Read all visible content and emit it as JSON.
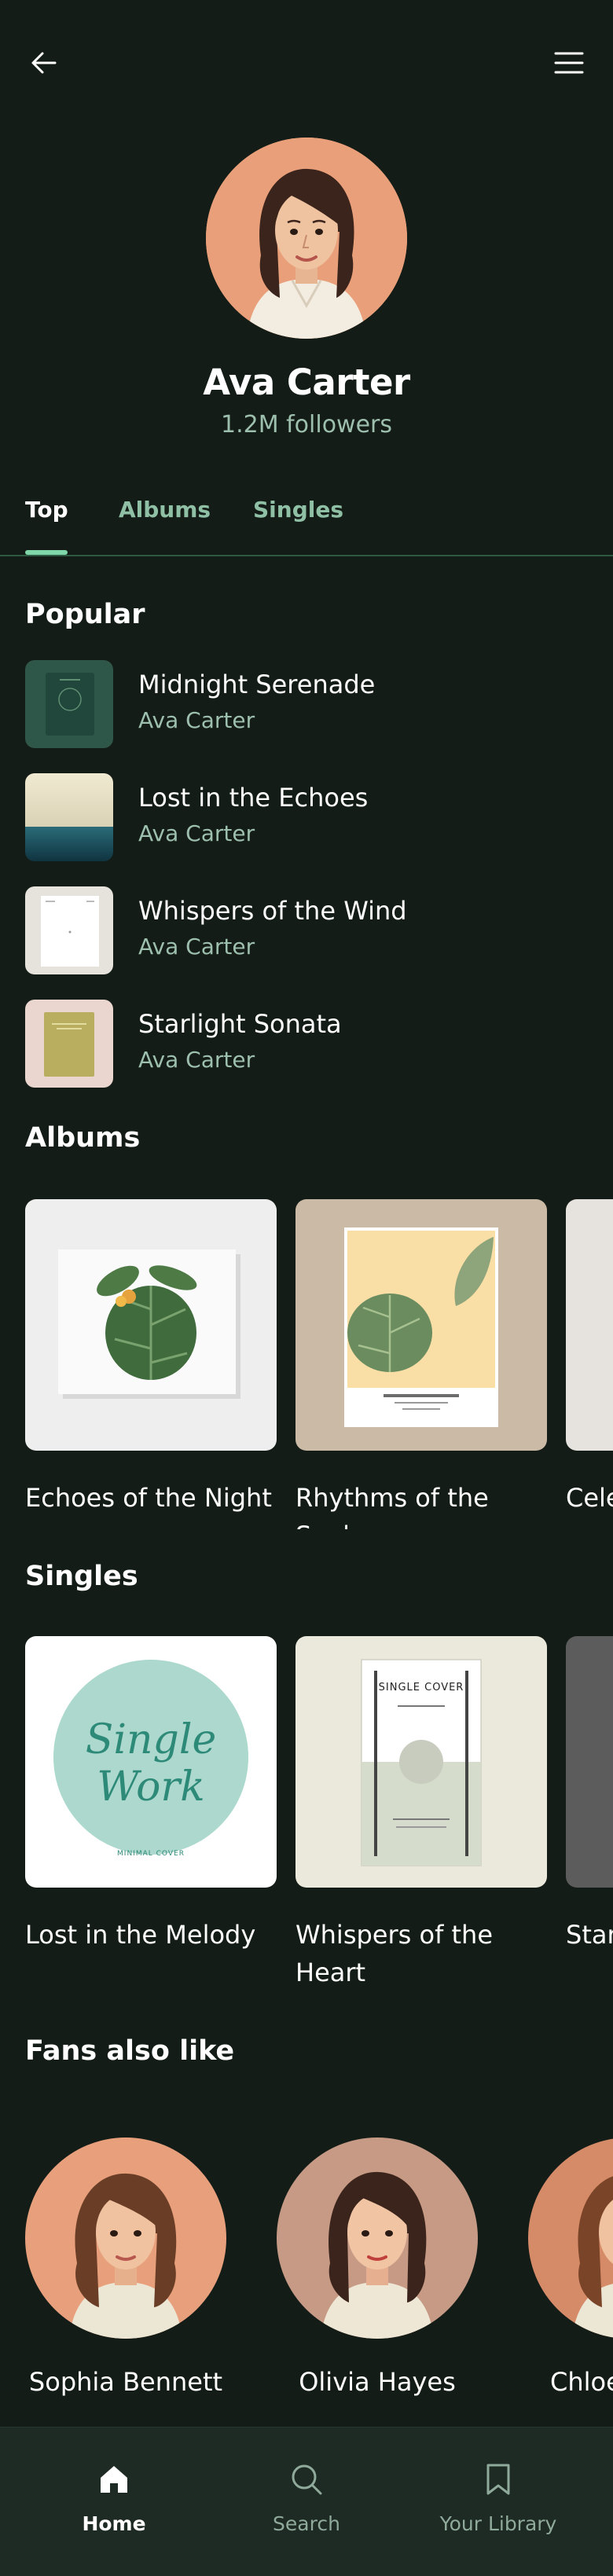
{
  "header": {
    "back_icon": "arrow-left-icon",
    "menu_icon": "hamburger-menu-icon"
  },
  "artist": {
    "name": "Ava Carter",
    "followers": "1.2M followers"
  },
  "tabs": [
    {
      "label": "Top",
      "active": true
    },
    {
      "label": "Albums",
      "active": false
    },
    {
      "label": "Singles",
      "active": false
    }
  ],
  "sections": {
    "popular": "Popular",
    "albums": "Albums",
    "singles": "Singles",
    "fans": "Fans also like"
  },
  "popular": [
    {
      "title": "Midnight Serenade",
      "artist": "Ava Carter"
    },
    {
      "title": "Lost in the Echoes",
      "artist": "Ava Carter"
    },
    {
      "title": "Whispers of the Wind",
      "artist": "Ava Carter"
    },
    {
      "title": "Starlight Sonata",
      "artist": "Ava Carter"
    }
  ],
  "albums": [
    {
      "title": "Echoes of the Night"
    },
    {
      "title": "Rhythms of the Soul"
    },
    {
      "title": "Cele"
    }
  ],
  "singles": [
    {
      "title": "Lost in the Melody",
      "cover_text": "Single Work",
      "cover_sub": "MINIMAL COVER"
    },
    {
      "title": "Whispers of the Heart",
      "cover_text": "SINGLE COVER"
    },
    {
      "title": "Star"
    }
  ],
  "fans": [
    {
      "name": "Sophia Bennett"
    },
    {
      "name": "Olivia Hayes"
    },
    {
      "name": "Chloe"
    }
  ],
  "nav": [
    {
      "label": "Home",
      "icon": "home-icon",
      "active": true
    },
    {
      "label": "Search",
      "icon": "search-icon",
      "active": false
    },
    {
      "label": "Your Library",
      "icon": "bookmark-icon",
      "active": false
    }
  ],
  "colors": {
    "background": "#141c17",
    "accent": "#7fd6a9",
    "muted_text": "#9dbfae"
  }
}
